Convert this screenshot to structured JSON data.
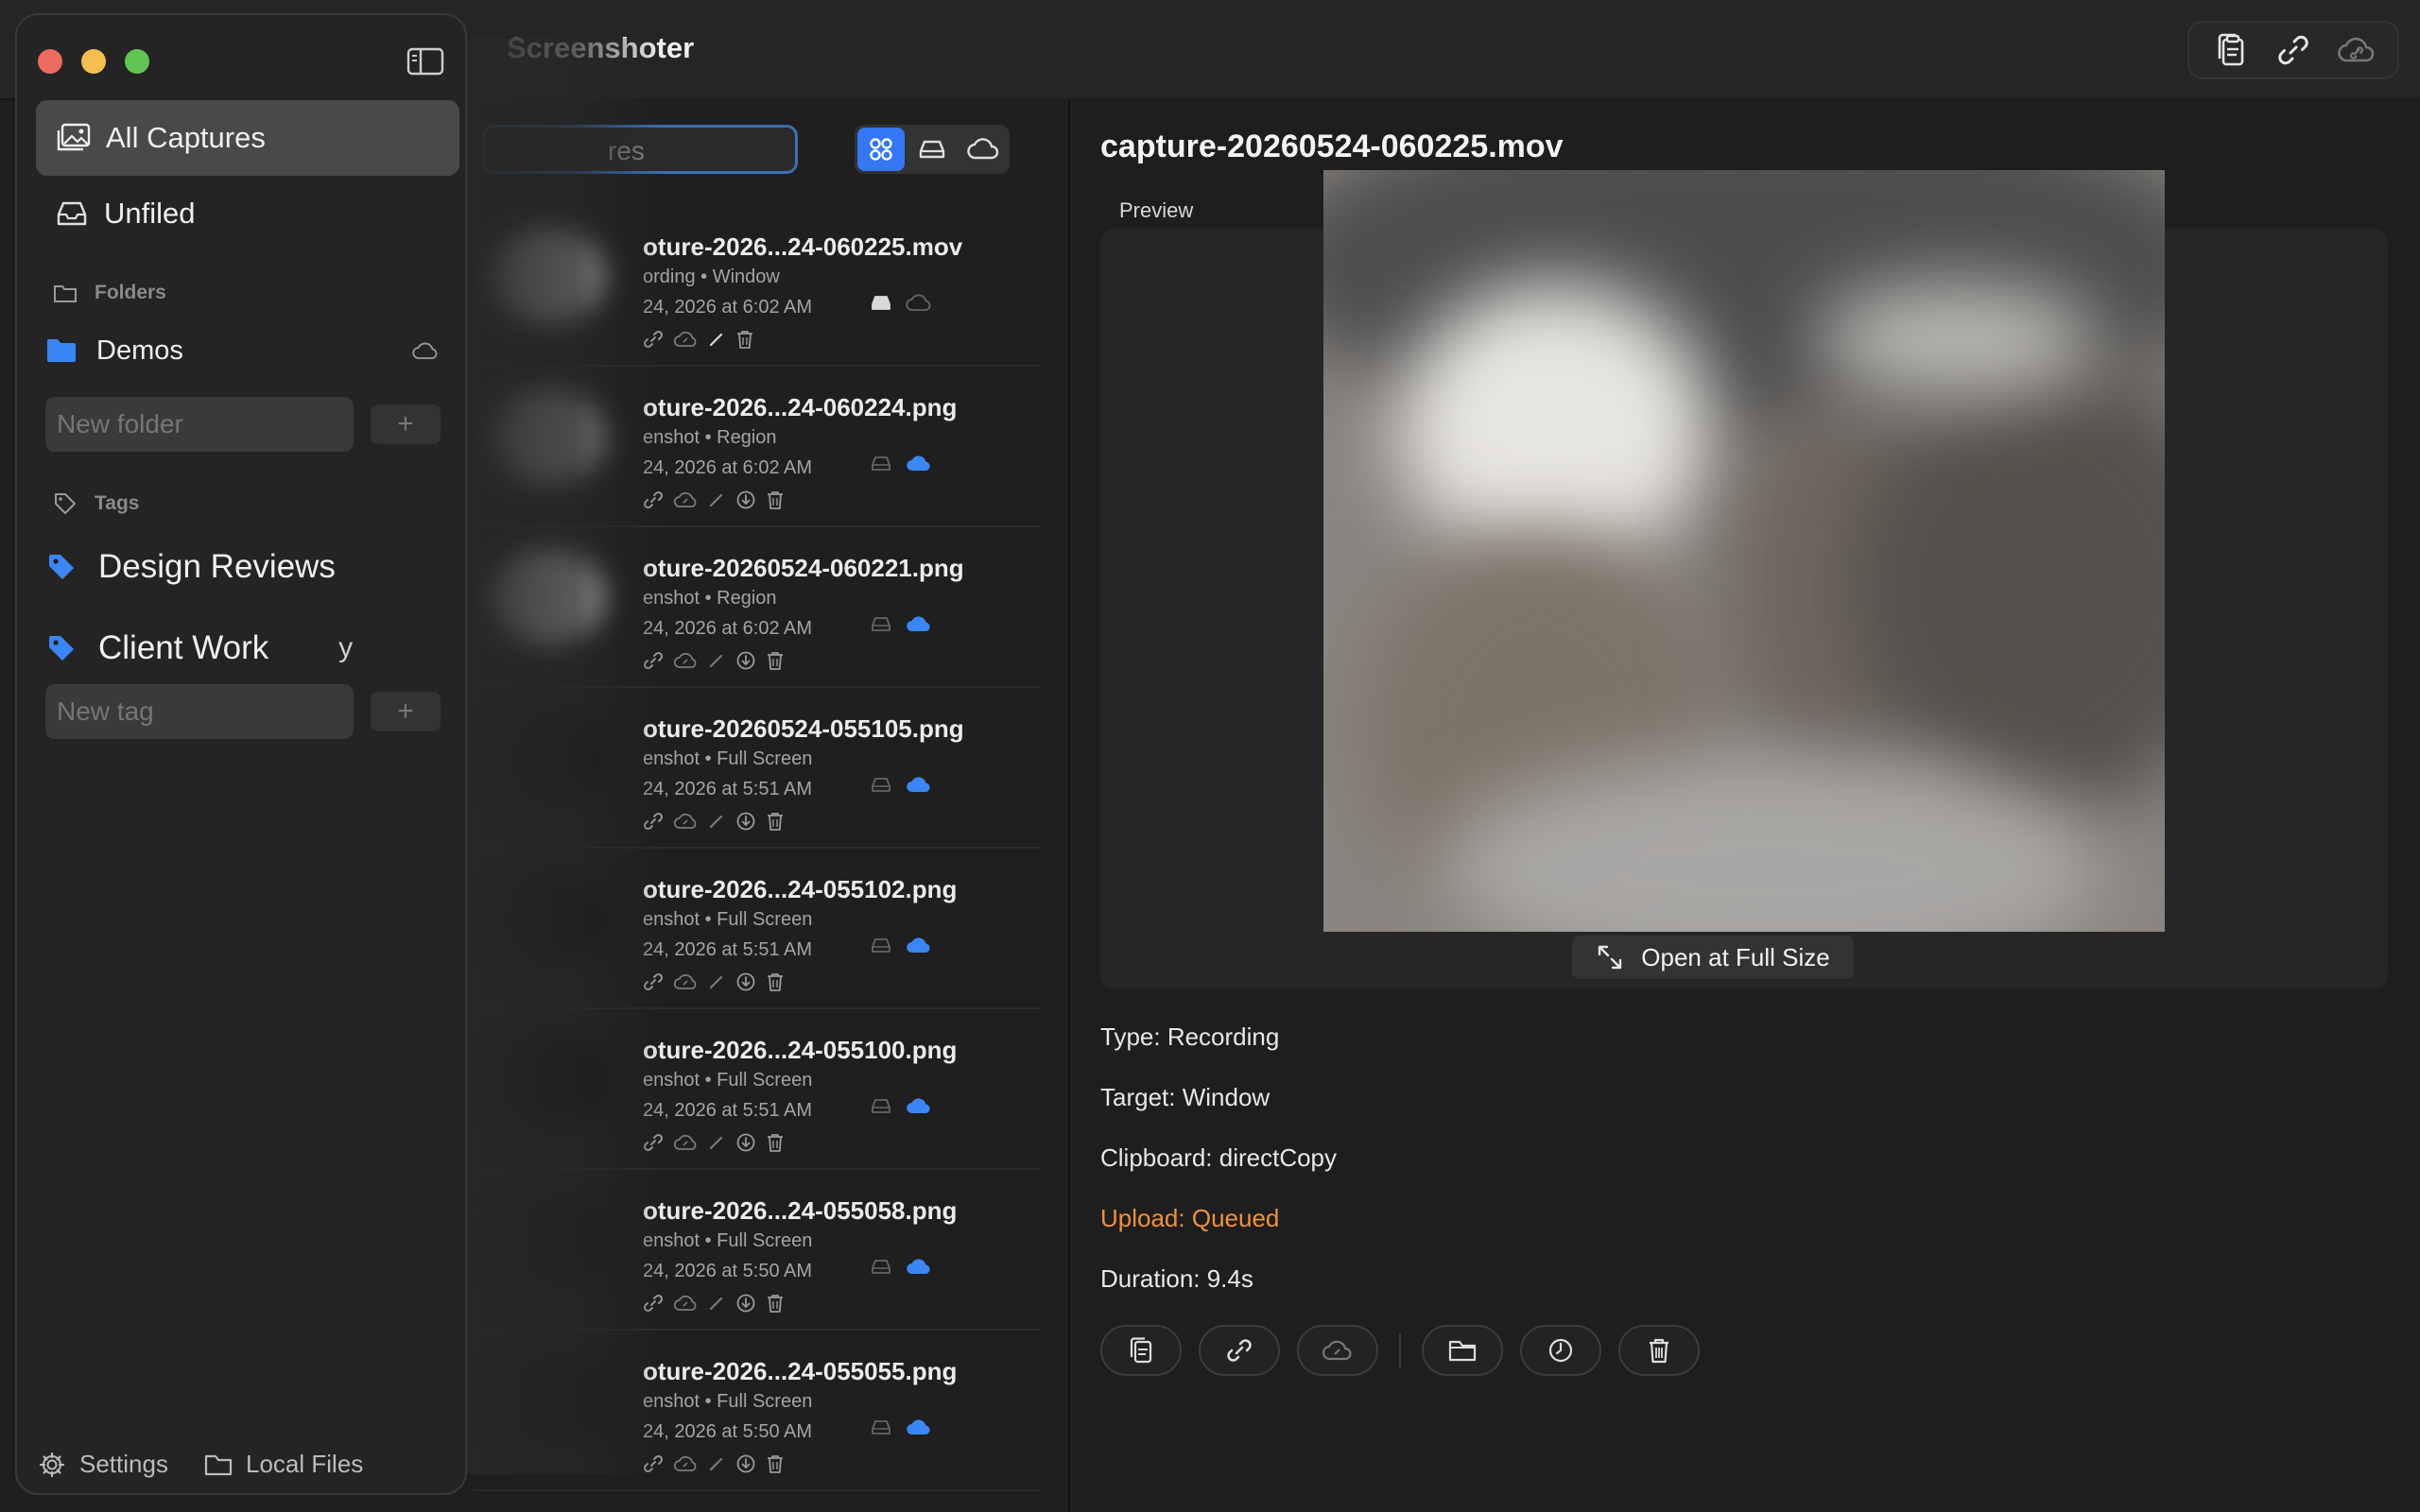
{
  "app": {
    "title": "Screenshoter"
  },
  "sidebar": {
    "all_captures": "All Captures",
    "unfiled": "Unfiled",
    "folders_header": "Folders",
    "folders": [
      {
        "label": "Demos",
        "color": "#3a86f5"
      }
    ],
    "new_folder_placeholder": "New folder",
    "add_label": "+",
    "tags_header": "Tags",
    "tags": [
      {
        "label": "Design Reviews",
        "color": "#3a86f5"
      },
      {
        "label": "Client Work",
        "color": "#3a86f5",
        "trailing": "y"
      }
    ],
    "new_tag_placeholder": "New tag",
    "settings": "Settings",
    "local_files": "Local Files"
  },
  "list": {
    "search_visible": "res",
    "items": [
      {
        "title": "oture-2026...24-060225.mov",
        "meta": "ording • Window",
        "date": "24, 2026 at 6:02 AM",
        "cloud": "queued"
      },
      {
        "title": "oture-2026...24-060224.png",
        "meta": "enshot • Region",
        "date": "24, 2026 at 6:02 AM",
        "cloud": "uploaded"
      },
      {
        "title": "oture-20260524-060221.png",
        "meta": "enshot • Region",
        "date": "24, 2026 at 6:02 AM",
        "cloud": "uploaded"
      },
      {
        "title": "oture-20260524-055105.png",
        "meta": "enshot • Full Screen",
        "date": "24, 2026 at 5:51 AM",
        "cloud": "uploaded"
      },
      {
        "title": "oture-2026...24-055102.png",
        "meta": "enshot • Full Screen",
        "date": "24, 2026 at 5:51 AM",
        "cloud": "uploaded"
      },
      {
        "title": "oture-2026...24-055100.png",
        "meta": "enshot • Full Screen",
        "date": "24, 2026 at 5:51 AM",
        "cloud": "uploaded"
      },
      {
        "title": "oture-2026...24-055058.png",
        "meta": "enshot • Full Screen",
        "date": "24, 2026 at 5:50 AM",
        "cloud": "uploaded"
      },
      {
        "title": "oture-2026...24-055055.png",
        "meta": "enshot • Full Screen",
        "date": "24, 2026 at 5:50 AM",
        "cloud": "uploaded"
      }
    ]
  },
  "detail": {
    "title": "capture-20260524-060225.mov",
    "preview_label": "Preview",
    "open_full": "Open at Full Size",
    "type": "Type: Recording",
    "target": "Target: Window",
    "clipboard": "Clipboard: directCopy",
    "upload": "Upload: Queued",
    "duration": "Duration: 9.4s"
  },
  "colors": {
    "accent": "#3478f6",
    "warning": "#f0913a"
  }
}
